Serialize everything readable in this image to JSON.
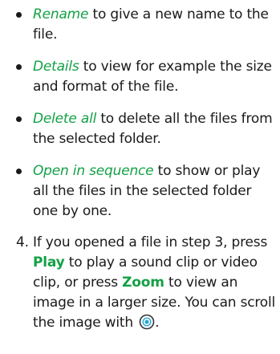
{
  "bullets": [
    {
      "keyword": "Rename",
      "rest": " to give a new name to the file."
    },
    {
      "keyword": "Details",
      "rest": " to view for example the size and format of the file."
    },
    {
      "keyword": "Delete all",
      "rest": " to delete all the files from the selected folder."
    },
    {
      "keyword": "Open in sequence",
      "rest": " to show or play all the files in the selected folder one by one."
    }
  ],
  "step": {
    "number": "4.",
    "text_a": "If you opened a file in step 3, press ",
    "button_play": "Play",
    "text_b": " to play a sound clip or video clip, or press ",
    "button_zoom": "Zoom",
    "text_c": " to view an image in a larger size. You can scroll the image with ",
    "text_end": ".",
    "scroll_icon": "navi-key-icon"
  },
  "colors": {
    "keyword": "#14a046",
    "icon_ring": "#333333",
    "icon_center": "#2aa7d8"
  }
}
